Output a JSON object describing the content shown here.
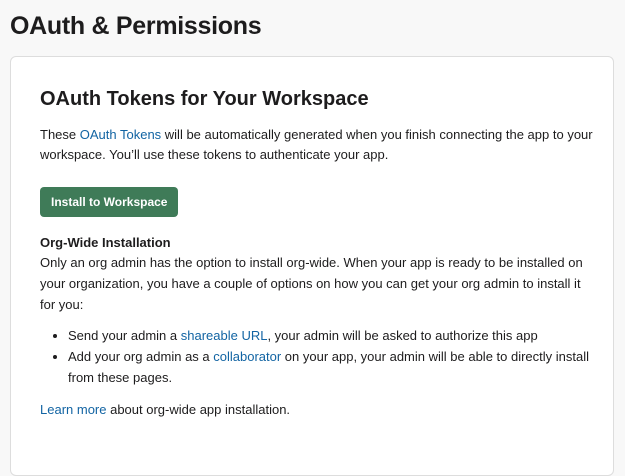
{
  "page": {
    "title": "OAuth & Permissions"
  },
  "tokens_section": {
    "title": "OAuth Tokens for Your Workspace",
    "intro_before": "These ",
    "intro_link": "OAuth Tokens",
    "intro_after": " will be automatically generated when you finish connecting the app to your workspace. You’ll use these tokens to authenticate your app.",
    "install_button": "Install to Workspace"
  },
  "org_wide": {
    "heading": "Org-Wide Installation",
    "description": "Only an org admin has the option to install org-wide. When your app is ready to be installed on your organization, you have a couple of options on how you can get your org admin to install it for you:",
    "options": [
      {
        "before": "Send your admin a ",
        "link": "shareable URL",
        "after": ", your admin will be asked to authorize this app"
      },
      {
        "before": "Add your org admin as a ",
        "link": "collaborator",
        "after": " on your app, your admin will be able to directly install from these pages."
      }
    ],
    "learn_more_link": "Learn more",
    "learn_more_after": " about org-wide app installation."
  },
  "colors": {
    "button_bg": "#3f7b58",
    "link": "#1264a3",
    "page_bg": "#f8f8f8"
  }
}
